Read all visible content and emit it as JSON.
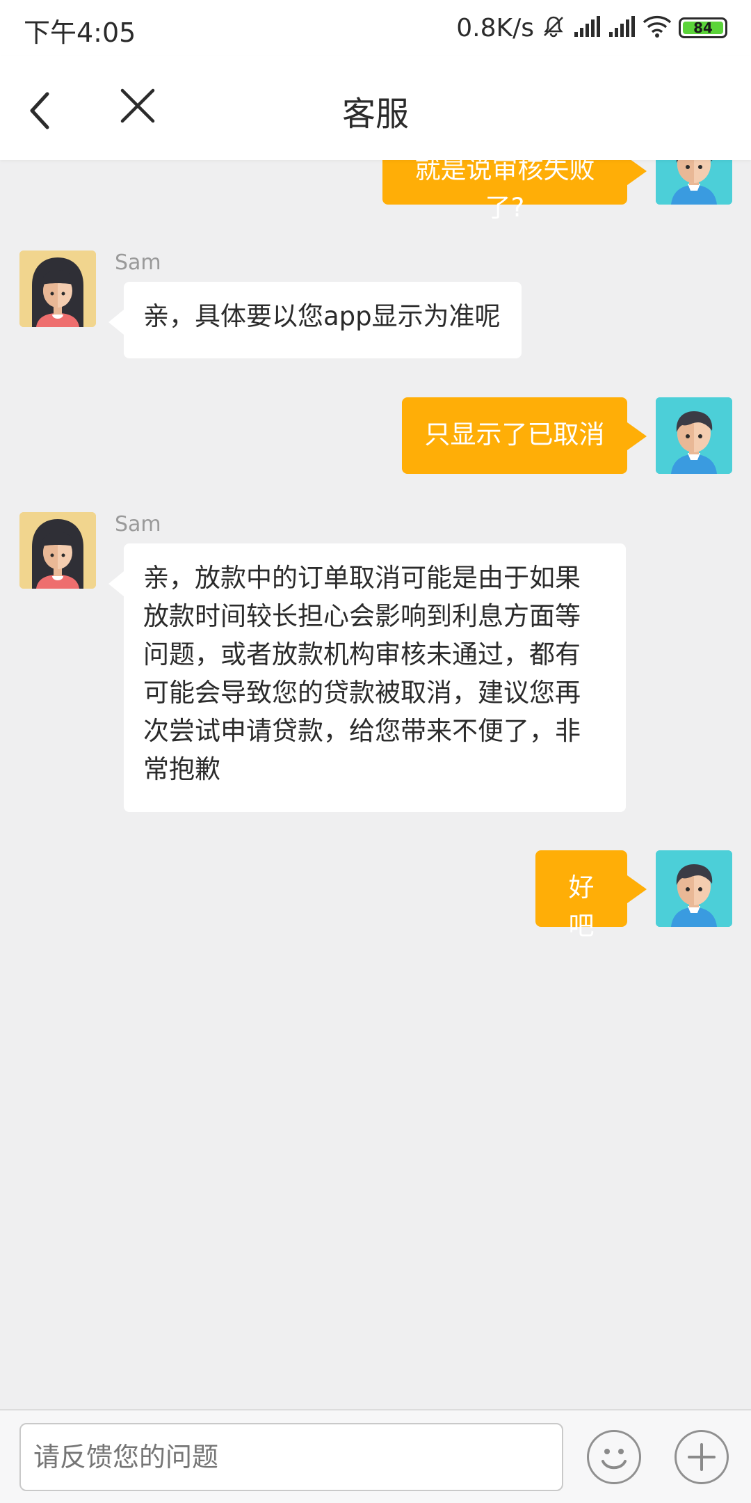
{
  "status_bar": {
    "time": "下午4:05",
    "speed": "0.8K/s",
    "battery": "84",
    "icons": [
      "mute-icon",
      "signal-icon",
      "signal-icon",
      "wifi-icon",
      "battery-icon"
    ]
  },
  "header": {
    "title": "客服",
    "back_icon": "chevron-left-icon",
    "close_icon": "close-icon"
  },
  "messages": [
    {
      "from": "user",
      "text": "就是说审核失败了?"
    },
    {
      "from": "agent",
      "sender": "Sam",
      "text": "亲，具体要以您app显示为准呢"
    },
    {
      "from": "user",
      "text": "只显示了已取消"
    },
    {
      "from": "agent",
      "sender": "Sam",
      "lines": [
        "亲，放款中的订单取消可能是由于如果",
        "放款时间较长担心会影响到利息方面等",
        "问题，或者放款机构审核未通过，都有",
        "可能会导致您的贷款被取消，建议您再",
        "次尝试申请贷款，给您带来不便了，非",
        "常抱歉"
      ]
    },
    {
      "from": "user",
      "text": "好吧"
    }
  ],
  "input": {
    "placeholder": "请反馈您的问题",
    "emoji_icon": "smiley-icon",
    "add_icon": "plus-icon"
  },
  "colors": {
    "user_bubble": "#ffae07",
    "agent_bubble": "#ffffff",
    "background": "#efeff0",
    "user_avatar": "#4ccfd8",
    "agent_avatar": "#f1d58e"
  }
}
